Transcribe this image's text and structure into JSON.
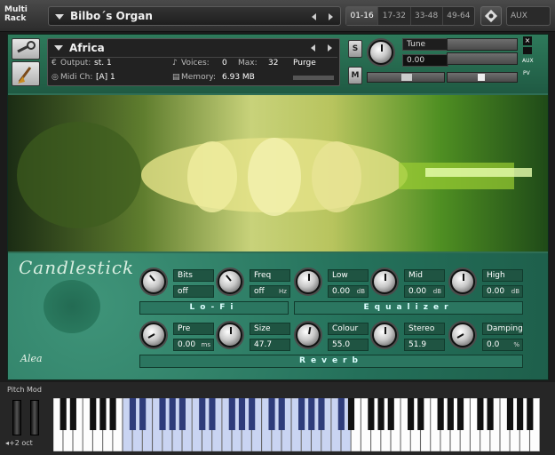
{
  "multirack": {
    "title": "Multi Rack",
    "name": "Bilbo´s Organ"
  },
  "pages": [
    "01-16",
    "17-32",
    "33-48",
    "49-64"
  ],
  "aux_label": "AUX",
  "instrument": {
    "name": "Africa",
    "output_label": "Output:",
    "output_value": "st. 1",
    "voices_label": "Voices:",
    "voices_value": "0",
    "max_label": "Max:",
    "max_value": "32",
    "purge_label": "Purge",
    "midi_label": "Midi Ch:",
    "midi_value": "[A] 1",
    "memory_label": "Memory:",
    "memory_value": "6.93 MB",
    "solo_label": "S",
    "mute_label": "M",
    "tune_label": "Tune",
    "tune_value": "0.00",
    "side_labels": [
      "AUX",
      "PV"
    ]
  },
  "panel": {
    "logo_text": "Candlestick",
    "logo_small": "Alea",
    "controls_row1": [
      {
        "label": "Bits",
        "value": "off",
        "unit": ""
      },
      {
        "label": "Freq",
        "value": "off",
        "unit": "Hz"
      },
      {
        "label": "Low",
        "value": "0.00",
        "unit": "dB"
      },
      {
        "label": "Mid",
        "value": "0.00",
        "unit": "dB"
      },
      {
        "label": "High",
        "value": "0.00",
        "unit": "dB"
      }
    ],
    "controls_row2": [
      {
        "label": "Pre",
        "value": "0.00",
        "unit": "ms"
      },
      {
        "label": "Size",
        "value": "47.7",
        "unit": ""
      },
      {
        "label": "Colour",
        "value": "55.0",
        "unit": ""
      },
      {
        "label": "Stereo",
        "value": "51.9",
        "unit": ""
      },
      {
        "label": "Damping",
        "value": "0.0",
        "unit": "%"
      }
    ],
    "sections": {
      "lofi": "Lo-Fi",
      "eq": "Equalizer",
      "reverb": "Reverb"
    }
  },
  "keyboard": {
    "pitch_mod_label": "Pitch Mod",
    "octave_label": "+2 oct"
  },
  "colors": {
    "panel_green": "#2f6e55",
    "mapped_key": "#c9d4f2",
    "mapped_black": "#2e3c7a"
  }
}
